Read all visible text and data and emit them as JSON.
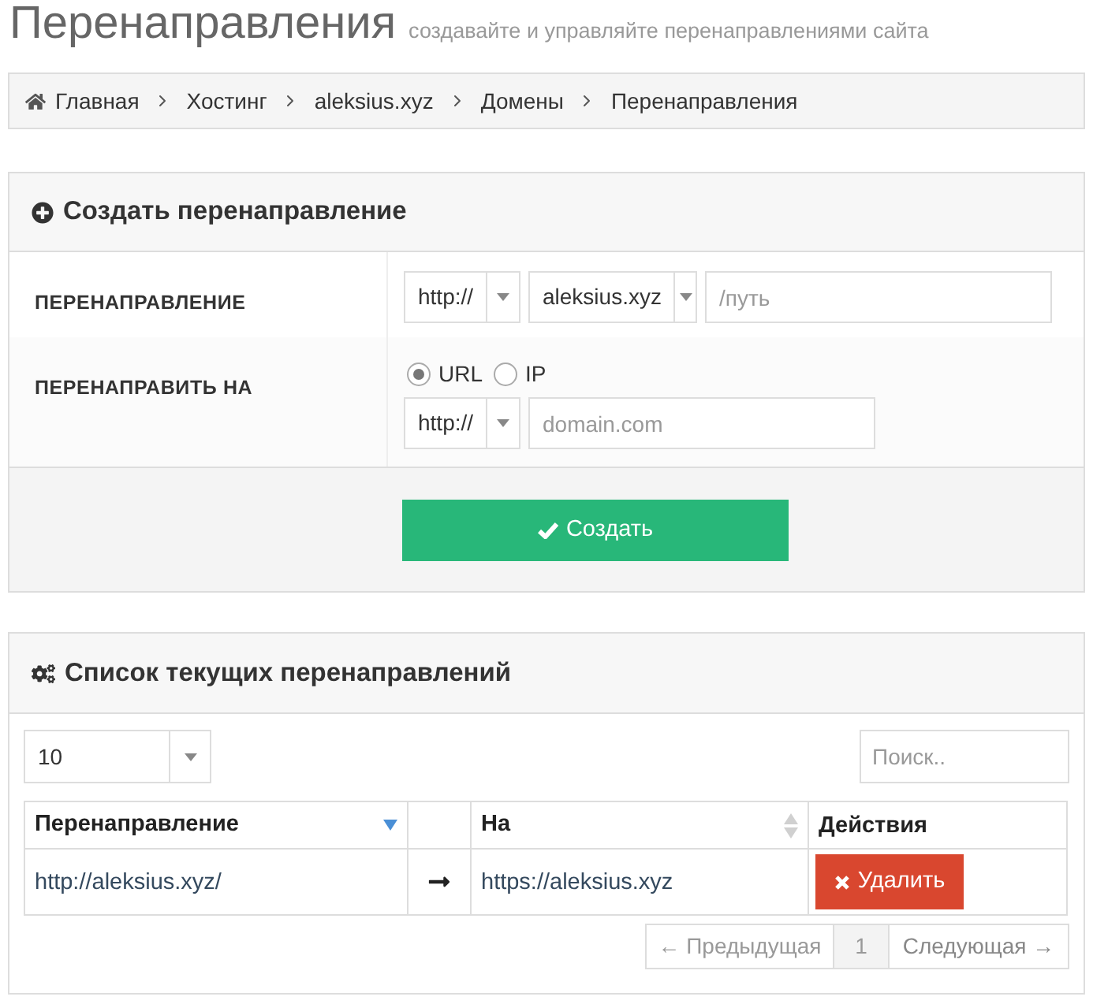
{
  "page_header": {
    "title": "Перенаправления",
    "subtitle": "создавайте и управляйте перенаправлениями сайта"
  },
  "breadcrumb": [
    {
      "label": "Главная",
      "kind": "home"
    },
    {
      "label": "Хостинг",
      "kind": "plain"
    },
    {
      "label": "aleksius.xyz",
      "kind": "plain"
    },
    {
      "label": "Домены",
      "kind": "plain"
    },
    {
      "label": "Перенаправления",
      "kind": "plain"
    }
  ],
  "create_panel": {
    "title": "Создать перенаправление",
    "rows": [
      {
        "kind": "source",
        "label": "ПЕРЕНАПРАВЛЕНИЕ",
        "scheme": "http://",
        "domain": "aleksius.xyz",
        "path_placeholder": "/путь"
      },
      {
        "kind": "target",
        "label": "ПЕРЕНАПРАВИТЬ НА",
        "radios": [
          {
            "label": "URL",
            "selected": true
          },
          {
            "label": "IP",
            "selected": false
          }
        ],
        "scheme": "http://",
        "host_placeholder": "domain.com"
      }
    ],
    "submit_button": "Создать"
  },
  "list_panel": {
    "title": "Список текущих перенаправлений",
    "page_length": "10",
    "search_placeholder": "Поиск..",
    "table": {
      "columns": [
        {
          "kind": "sortable",
          "label": "Перенаправление",
          "sorted": true
        },
        {
          "kind": "blank"
        },
        {
          "kind": "sortable",
          "label": "На",
          "sorted": false
        },
        {
          "kind": "plain",
          "label": "Действия"
        }
      ],
      "rows": [
        {
          "from": "http://aleksius.xyz/",
          "to": "https://aleksius.xyz",
          "action": "Удалить"
        }
      ]
    },
    "pagination": {
      "previous": {
        "label": "← Предыдущая",
        "disabled": true
      },
      "pages": [
        {
          "label": "1",
          "selected": true
        }
      ],
      "next": {
        "label": "Следующая →",
        "disabled": true
      }
    }
  }
}
